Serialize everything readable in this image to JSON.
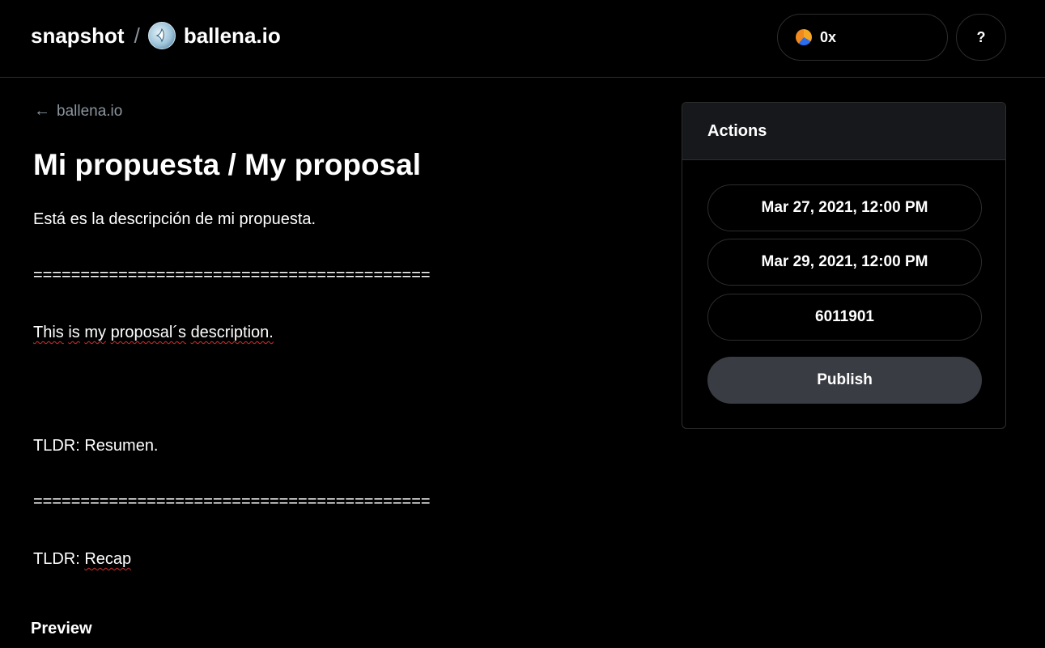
{
  "header": {
    "brand": "snapshot",
    "separator": "/",
    "space_name": "ballena.io",
    "account_label": "0x",
    "help_label": "?"
  },
  "back_link": {
    "arrow": "←",
    "label": "ballena.io"
  },
  "proposal": {
    "title": "Mi propuesta / My proposal",
    "body": {
      "line1": "Está es la descripción de mi propuesta.",
      "divider1": "==========================================",
      "line2_words": [
        "This",
        "is",
        "my",
        "proposal´s",
        "description."
      ],
      "line3": "TLDR: Resumen.",
      "divider2": "==========================================",
      "line4_prefix": "TLDR:",
      "line4_word": "Recap"
    },
    "preview_label": "Preview"
  },
  "actions": {
    "title": "Actions",
    "start_date": "Mar 27, 2021, 12:00 PM",
    "end_date": "Mar 29, 2021, 12:00 PM",
    "snapshot_block": "6011901",
    "publish_label": "Publish"
  },
  "colors": {
    "background": "#000000",
    "border": "#2d2d2d",
    "muted_text": "#8b949e",
    "publish_button": "#393d43",
    "spellcheck": "#d32f2f"
  },
  "icons": {
    "back": "arrow-left-icon",
    "space_avatar": "whale-icon",
    "account_avatar": "account-avatar-icon"
  }
}
